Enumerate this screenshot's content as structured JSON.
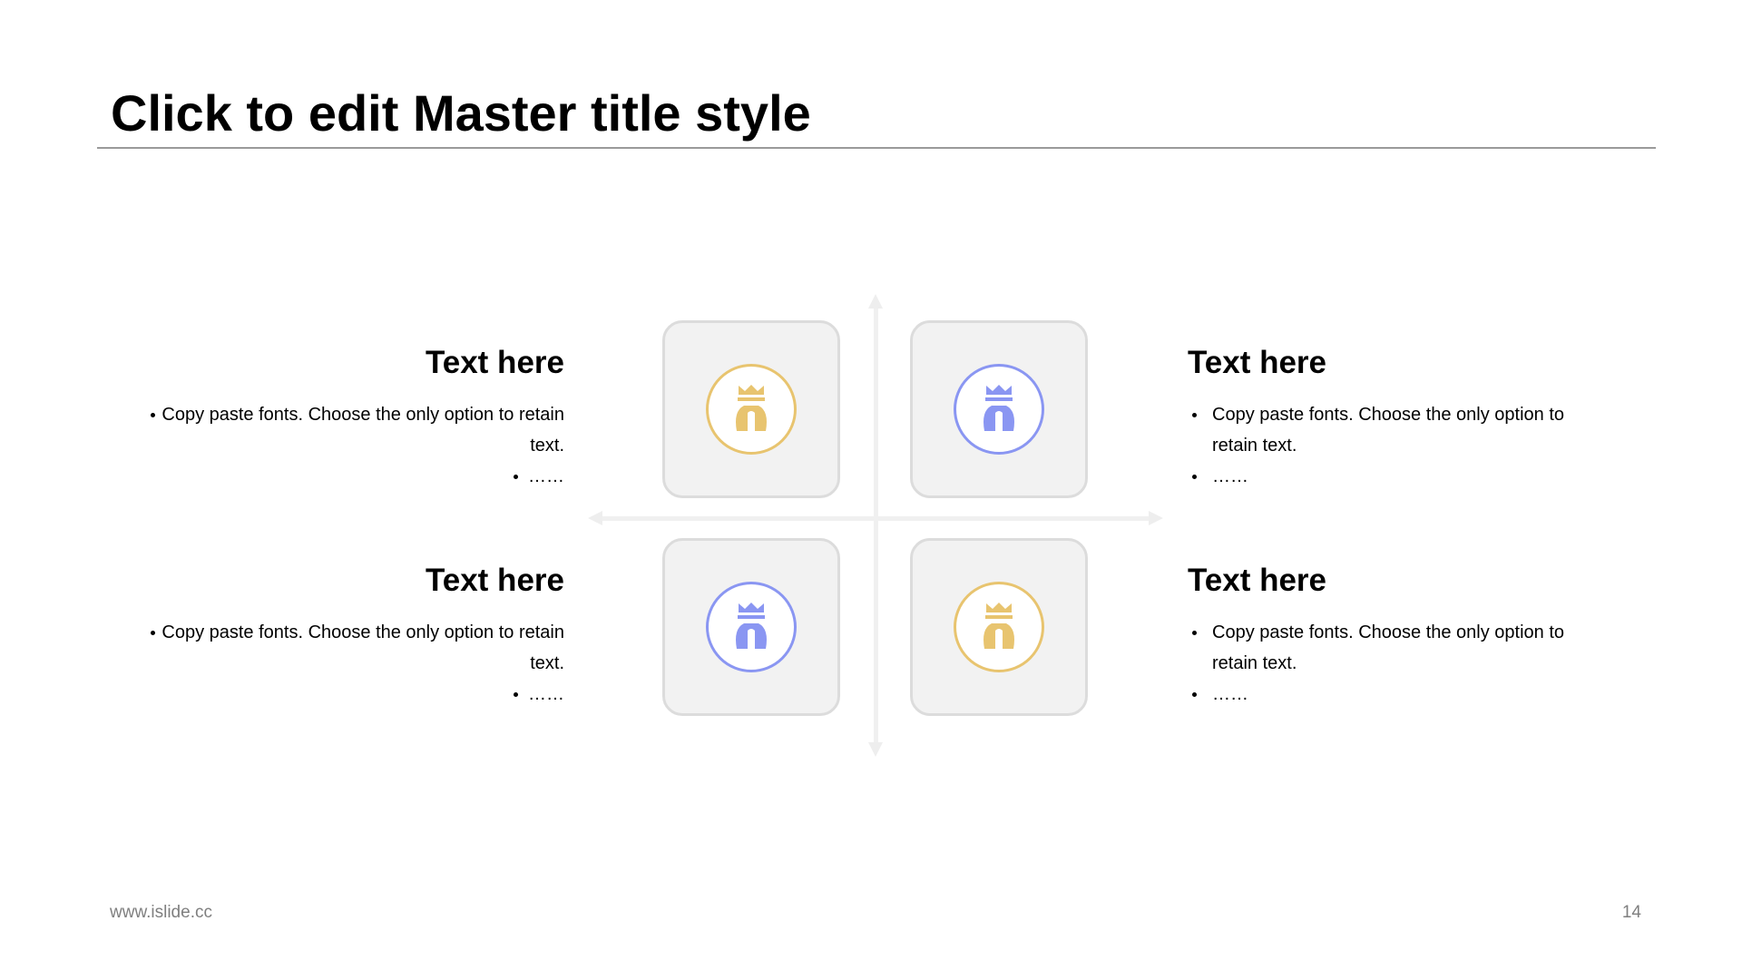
{
  "slide": {
    "title": "Click to edit Master title style",
    "footer_url": "www.islide.cc",
    "page_number": "14"
  },
  "colors": {
    "gold": "#e8c46f",
    "blue": "#8a96f2",
    "tile_fill": "#f2f2f2",
    "tile_border": "#dcdcdc",
    "axis": "#f0f0f0"
  },
  "quadrants": [
    {
      "position": "top-left",
      "heading": "Text here",
      "bullet_1": "Copy paste fonts. Choose the only option to retain text.",
      "bullet_2": "……",
      "icon": "king-icon",
      "icon_color": "gold"
    },
    {
      "position": "top-right",
      "heading": "Text here",
      "bullet_1": "Copy paste fonts. Choose the only option to retain text.",
      "bullet_2": "……",
      "icon": "king-icon",
      "icon_color": "blue"
    },
    {
      "position": "bottom-left",
      "heading": "Text here",
      "bullet_1": "Copy paste fonts. Choose the only option to retain text.",
      "bullet_2": "……",
      "icon": "king-icon",
      "icon_color": "blue"
    },
    {
      "position": "bottom-right",
      "heading": "Text here",
      "bullet_1": "Copy paste fonts. Choose the only option to retain text.",
      "bullet_2": "……",
      "icon": "king-icon",
      "icon_color": "gold"
    }
  ]
}
